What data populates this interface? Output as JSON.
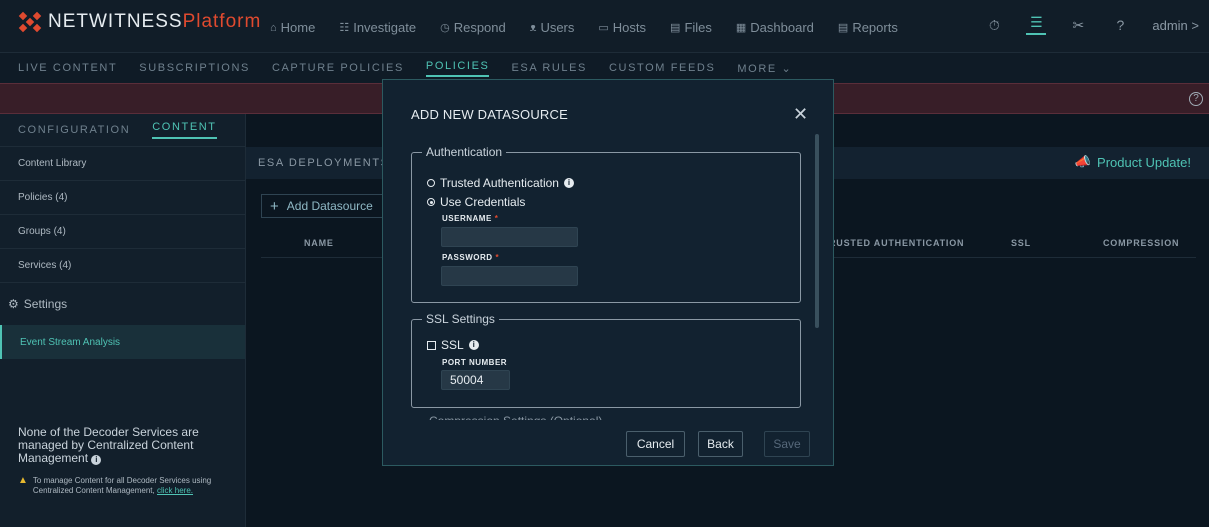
{
  "brand": {
    "name": "NETWITNESS",
    "suffix": "Platform"
  },
  "topnav": [
    {
      "icon": "home-icon",
      "glyph": "⌂",
      "label": "Home"
    },
    {
      "icon": "investigate-icon",
      "glyph": "☷",
      "label": "Investigate"
    },
    {
      "icon": "respond-icon",
      "glyph": "◷",
      "label": "Respond"
    },
    {
      "icon": "users-icon",
      "glyph": "ᴥ",
      "label": "Users"
    },
    {
      "icon": "hosts-icon",
      "glyph": "▭",
      "label": "Hosts"
    },
    {
      "icon": "files-icon",
      "glyph": "▤",
      "label": "Files"
    },
    {
      "icon": "dashboard-icon",
      "glyph": "▦",
      "label": "Dashboard"
    },
    {
      "icon": "reports-icon",
      "glyph": "▤",
      "label": "Reports"
    }
  ],
  "topright": {
    "user": "admin >"
  },
  "subnav": [
    "LIVE CONTENT",
    "SUBSCRIPTIONS",
    "CAPTURE POLICIES",
    "POLICIES",
    "ESA RULES",
    "CUSTOM FEEDS",
    "MORE ⌄"
  ],
  "sidebar": {
    "tabs": [
      "CONFIGURATION",
      "CONTENT"
    ],
    "items": [
      "Content Library",
      "Policies (4)",
      "Groups (4)",
      "Services (4)"
    ],
    "settings": "Settings",
    "active_item": "Event Stream Analysis",
    "note": "None of the Decoder Services are managed by Centralized Content Management",
    "sub_note": "To manage Content for all Decoder Services using Centralized Content Management,",
    "sub_link": "click here."
  },
  "main": {
    "header": "ESA DEPLOYMENTS",
    "product_update": "Product Update!",
    "add_button": "Add Datasource",
    "columns": [
      "NAME",
      "RUSTED AUTHENTICATION",
      "SSL",
      "COMPRESSION"
    ]
  },
  "modal": {
    "title": "ADD NEW DATASOURCE",
    "auth_legend": "Authentication",
    "trusted_auth": "Trusted Authentication",
    "use_credentials": "Use Credentials",
    "username_label": "USERNAME",
    "password_label": "PASSWORD",
    "required_mark": "*",
    "ssl_legend": "SSL Settings",
    "ssl_label": "SSL",
    "port_label": "PORT NUMBER",
    "port_value": "50004",
    "compression_legend": "Compression Settings (Optional)",
    "cancel": "Cancel",
    "back": "Back",
    "save": "Save"
  }
}
